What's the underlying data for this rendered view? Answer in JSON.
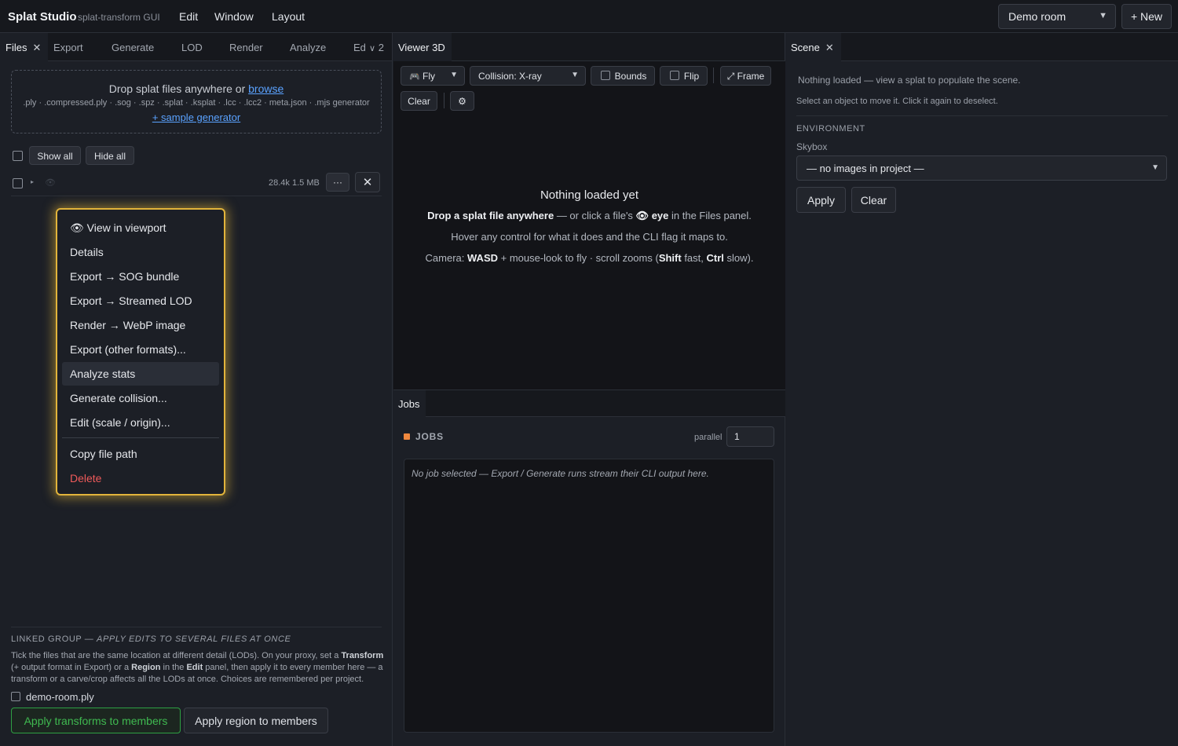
{
  "menubar": {
    "brand": "Splat Studio",
    "brand_sub": "splat-transform GUI",
    "menus": [
      "Edit",
      "Window",
      "Layout"
    ],
    "project_select": "Demo room",
    "new_button": "+ New"
  },
  "left": {
    "tabs": [
      "Files",
      "Export",
      "Generate",
      "LOD",
      "Render",
      "Analyze",
      "Ed"
    ],
    "overflow_count": "2",
    "dropzone": {
      "title": "Drop splat files anywhere or ",
      "browse_link": "browse",
      "formats": ".ply · .compressed.ply · .sog · .spz · .splat · .ksplat · .lcc · .lcc2 · meta.json · .mjs generator",
      "sample_link": "+ sample generator"
    },
    "show_all": "Show all",
    "hide_all": "Hide all",
    "file_row": {
      "meta": "28.4k  1.5 MB",
      "more_button": "···",
      "close_button": "✕"
    },
    "context_menu": {
      "items": [
        "👁 View in viewport",
        "Details",
        "Export → SOG bundle",
        "Export → Streamed LOD",
        "Render → WebP image",
        "Export (other formats)...",
        "Analyze stats",
        "Generate collision...",
        "Edit (scale / origin)...",
        "Copy file path",
        "Delete"
      ]
    },
    "linked": {
      "title_prefix": "LINKED GROUP — ",
      "title_em": "APPLY EDITS TO SEVERAL FILES AT ONCE",
      "desc": {
        "p1": "Tick the files that are the same location at different detail (LODs). On your proxy, set a ",
        "b1": "Transform",
        "p2": " (+ output format in Export) or a ",
        "b2": "Region",
        "p3": " in the ",
        "b3": "Edit",
        "p4": " panel, then apply it to every member here — a transform or a carve/crop affects all the LODs at once. Choices are remembered per project."
      },
      "file": "demo-room.ply",
      "apply_transforms": "Apply transforms to members",
      "apply_region": "Apply region to members"
    }
  },
  "middle": {
    "tab": "Viewer 3D",
    "toolbar": {
      "mode_icon": "🎮",
      "mode": "Fly",
      "collision": "Collision: X-ray",
      "bounds": "Bounds",
      "flip": "Flip",
      "frame": "⤢ Frame",
      "clear": "Clear",
      "settings": "⚙"
    },
    "empty": {
      "title": "Nothing loaded yet",
      "l1_b1": "Drop a splat file anywhere",
      "l1_p1": " — or click a file's ",
      "l1_icon": "👁",
      "l1_b2": "eye",
      "l1_p2": " in the Files panel.",
      "l2": "Hover any control for what it does and the CLI flag it maps to.",
      "l3_p1": "Camera: ",
      "l3_b1": "WASD",
      "l3_p2": " + mouse-look to fly · scroll zooms (",
      "l3_b2": "Shift",
      "l3_p3": " fast, ",
      "l3_b3": "Ctrl",
      "l3_p4": " slow)."
    },
    "jobs": {
      "tab": "Jobs",
      "header": "JOBS",
      "parallel_label": "parallel",
      "parallel_value": "1",
      "log_placeholder": "No job selected — Export / Generate runs stream their CLI output here."
    }
  },
  "right": {
    "tab": "Scene",
    "empty": "Nothing loaded — view a splat to populate the scene.",
    "hint": "Select an object to move it. Click it again to deselect.",
    "env_label": "ENVIRONMENT",
    "skybox_label": "Skybox",
    "skybox_value": "— no images in project —",
    "apply": "Apply",
    "clear": "Clear"
  },
  "colors": {
    "accent_link": "#5aa2ff",
    "highlight_outline": "#e2b43b",
    "success": "#3fb950",
    "danger": "#ef5a5a",
    "jobs_dot": "#f0883e"
  }
}
